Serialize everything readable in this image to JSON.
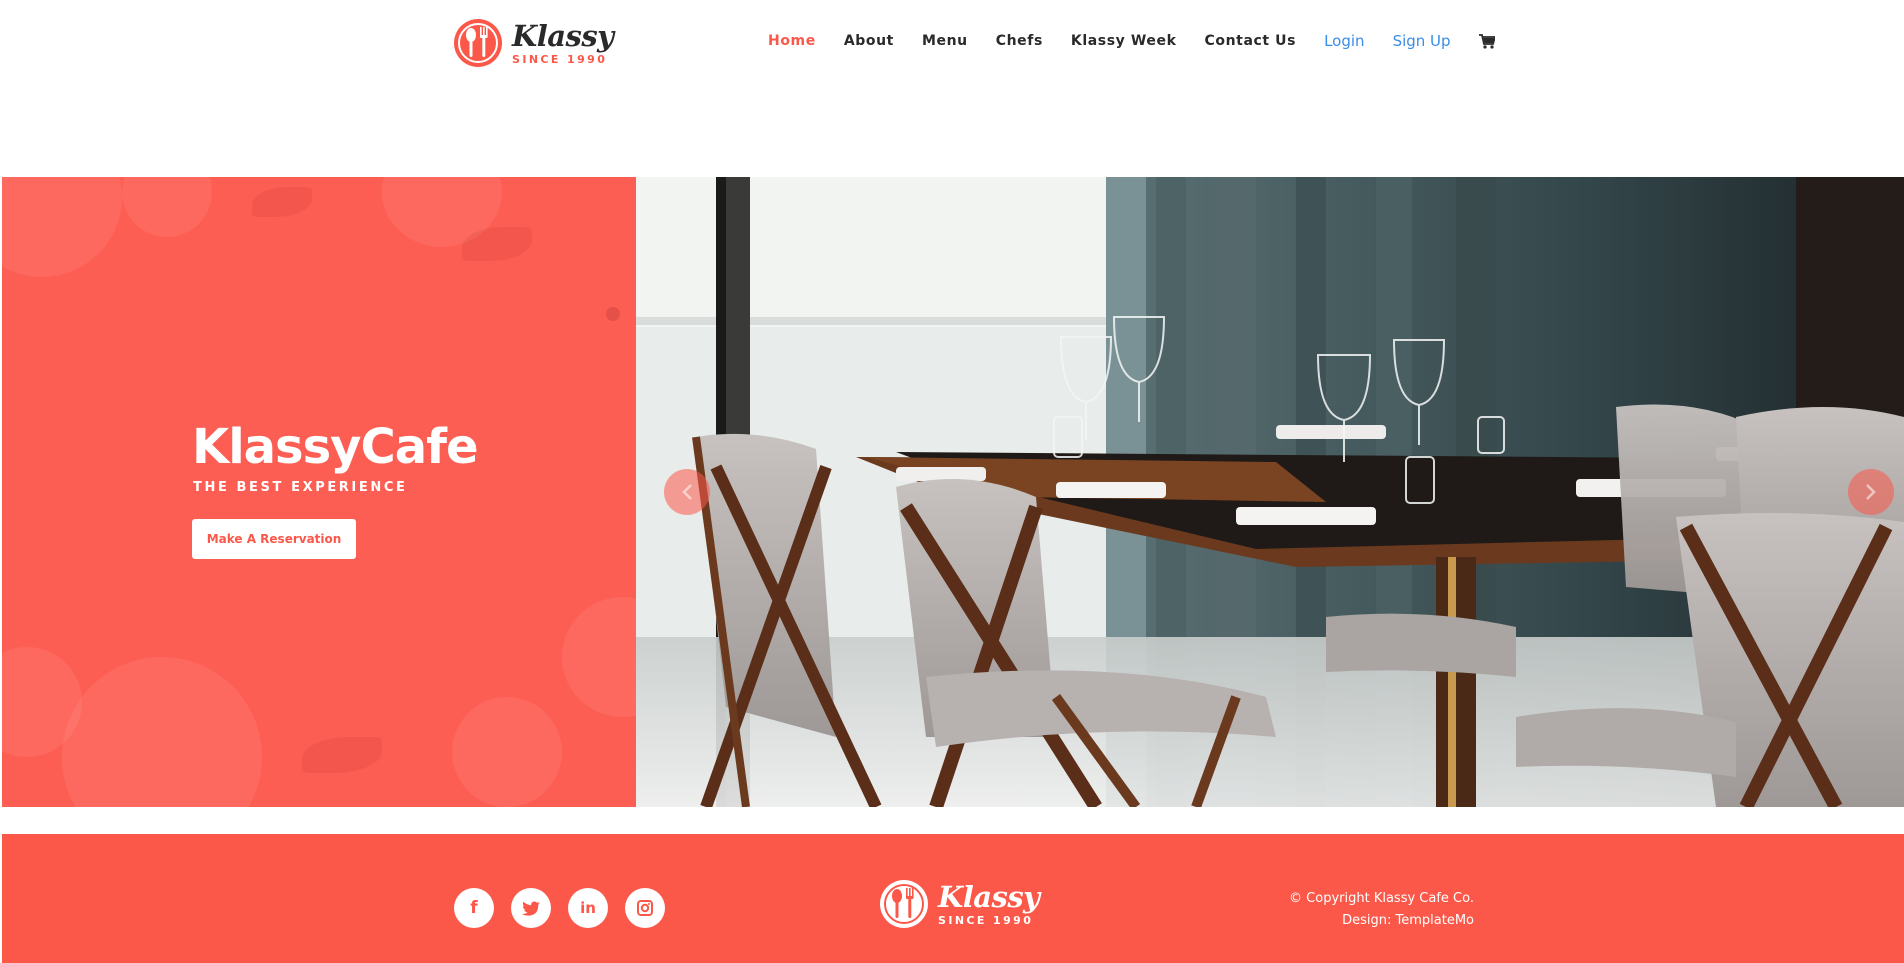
{
  "header": {
    "logo": {
      "word": "Klassy",
      "since": "SINCE 1990"
    },
    "nav": [
      {
        "label": "Home",
        "active": true
      },
      {
        "label": "About"
      },
      {
        "label": "Menu"
      },
      {
        "label": "Chefs"
      },
      {
        "label": "Klassy Week"
      },
      {
        "label": "Contact Us"
      }
    ],
    "auth": {
      "login": "Login",
      "signup": "Sign Up"
    },
    "cart_icon": "shopping-cart-icon"
  },
  "hero": {
    "title": "KlassyCafe",
    "subtitle": "THE BEST EXPERIENCE",
    "cta": "Make A Reservation",
    "prev_icon": "chevron-left-icon",
    "next_icon": "chevron-right-icon"
  },
  "footer": {
    "social": [
      {
        "icon": "facebook-icon",
        "glyph": "f"
      },
      {
        "icon": "twitter-icon",
        "glyph": "t"
      },
      {
        "icon": "linkedin-icon",
        "glyph": "in"
      },
      {
        "icon": "instagram-icon",
        "glyph": ""
      }
    ],
    "logo": {
      "word": "Klassy",
      "since": "SINCE 1990"
    },
    "copyright": "© Copyright Klassy Cafe Co.",
    "design": "Design: TemplateMo"
  },
  "colors": {
    "brand": "#fb5849",
    "hero_panel": "#fd5e53",
    "link_blue": "#3a8ce6",
    "text_dark": "#2a2a2a"
  }
}
